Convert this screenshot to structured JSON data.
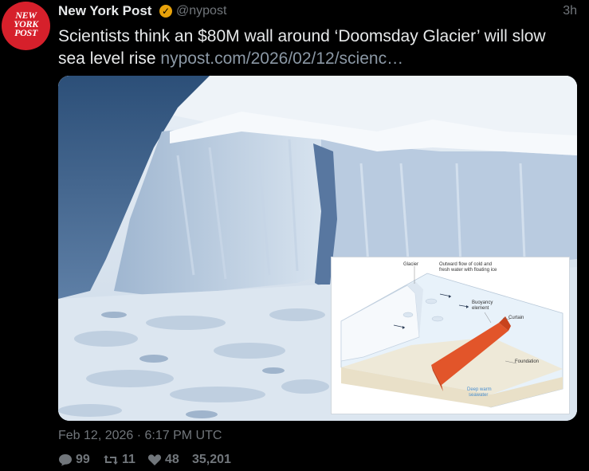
{
  "post": {
    "author_name": "New York Post",
    "handle": "@nypost",
    "time": "3h",
    "text": "Scientists think an $80M wall around ‘Doomsday Glacier’ will slow sea level rise ",
    "link": "nypost.com/2026/02/12/scienc…",
    "date": "Feb 12, 2026 · 6:17 PM UTC"
  },
  "avatar": {
    "line1": "NEW",
    "line2": "YORK",
    "line3": "POST"
  },
  "diagram": {
    "glacier": "Glacier",
    "outward_line1": "Outward flow of cold and",
    "outward_line2": "fresh water with floating ice",
    "buoyancy_line1": "Buoyancy",
    "buoyancy_line2": "element",
    "curtain": "Curtain",
    "foundation": "Foundation",
    "deep_line1": "Deep warm",
    "deep_line2": "seawater"
  },
  "stats": {
    "replies": "99",
    "retweets": "11",
    "likes": "48",
    "views": "35,201"
  },
  "colors": {
    "background": "#000000",
    "brand_red": "#d6202b",
    "verified_gold": "#e8a20a",
    "muted_text": "#71767b",
    "curtain_orange": "#e2552a"
  },
  "icons": [
    "verified-badge-icon",
    "reply-icon",
    "retweet-icon",
    "like-icon"
  ]
}
